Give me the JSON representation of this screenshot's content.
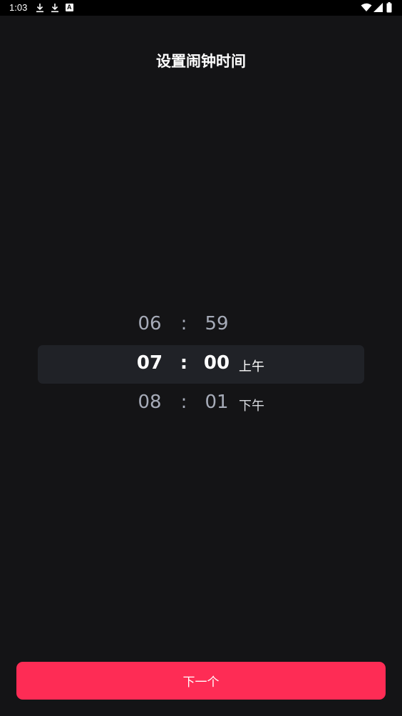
{
  "status_bar": {
    "time": "1:03",
    "icons": [
      "download-icon",
      "download-icon",
      "a-badge-icon",
      "wifi-icon",
      "signal-icon",
      "battery-icon"
    ],
    "badge_letter": "A"
  },
  "page": {
    "title": "设置闹钟时间"
  },
  "picker": {
    "rows": [
      {
        "hour": "06",
        "colon": ":",
        "minute": "59",
        "period": ""
      },
      {
        "hour": "07",
        "colon": ":",
        "minute": "00",
        "period": "上午"
      },
      {
        "hour": "08",
        "colon": ":",
        "minute": "01",
        "period": "下午"
      }
    ],
    "selected_index": 1
  },
  "footer": {
    "next_label": "下一个"
  },
  "colors": {
    "background": "#141416",
    "accent": "#fe2c55",
    "highlight": "#202227",
    "dim_text": "#a6abb8"
  }
}
